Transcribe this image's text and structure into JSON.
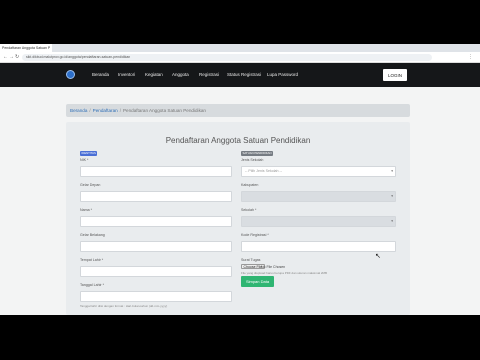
{
  "browser": {
    "tab_title": "Pendaftaran Anggota Satuan P",
    "url": "sikt.dikbud.malutprov.go.id/anggota/pendaftaran-satuan-pendidikan",
    "back_icon": "back-arrow-icon",
    "forward_icon": "forward-arrow-icon",
    "reload_icon": "reload-icon",
    "menu_icon": "kebab-menu-icon"
  },
  "header": {
    "menu": [
      "Beranda",
      "Inventori",
      "Kegiatan",
      "Anggota",
      "Registrasi",
      "Status Registrasi",
      "Lupa Password"
    ],
    "login_label": "LOGIN"
  },
  "breadcrumb": {
    "items": [
      "Beranda",
      "Pendaftaran",
      "Pendaftaran Anggota Satuan Pendidikan"
    ],
    "separator": "/"
  },
  "form": {
    "title": "Pendaftaran Anggota Satuan Pendidikan",
    "left_badge": "IDENTITAS",
    "right_badge": "SATUAN PENDIDIKAN",
    "left_fields": [
      {
        "label": "NIK *",
        "value": ""
      },
      {
        "label": "Gelar Depan",
        "value": ""
      },
      {
        "label": "Nama *",
        "value": ""
      },
      {
        "label": "Gelar Belakang",
        "value": ""
      },
      {
        "label": "Tempat Lahir *",
        "value": ""
      },
      {
        "label": "Tanggal Lahir *",
        "value": ""
      }
    ],
    "left_hint": "Tanggal lahir diisi dengan format : Hari-bulan-tahun (dd-mm-yyyy)",
    "right_fields": [
      {
        "label": "Jenis Sekolah",
        "placeholder": "-- Pilih Jenis Sekolah --"
      },
      {
        "label": "Kabupaten",
        "placeholder": ""
      },
      {
        "label": "Sekolah *",
        "placeholder": ""
      },
      {
        "label": "Kode Registrasi *",
        "placeholder": ""
      }
    ],
    "file_label": "Surat Tugas",
    "file_button": "Choose File",
    "file_status": "No File Chosen",
    "file_hint": "File yang diupload harus berupa PDF dan ukuran maksimal 2MB",
    "submit_label": "Simpan Data"
  }
}
